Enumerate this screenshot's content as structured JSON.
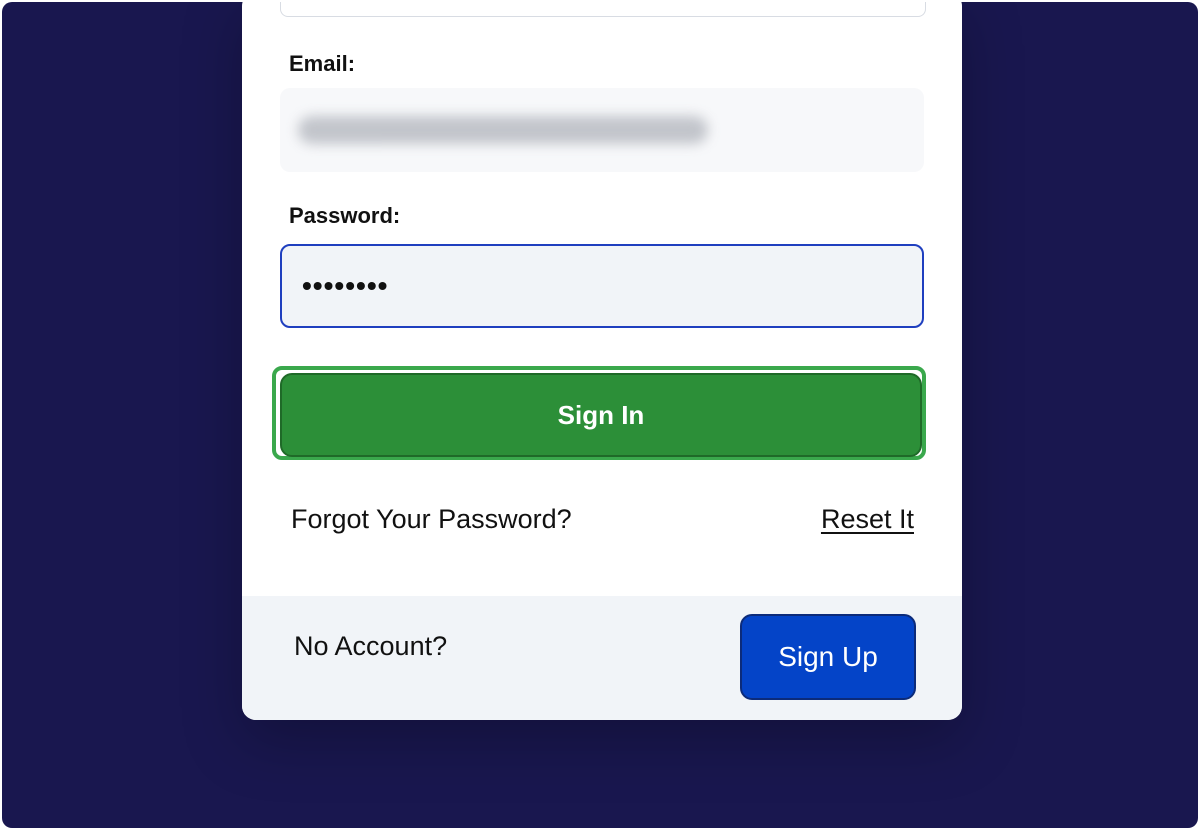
{
  "form": {
    "email_label": "Email:",
    "email_value": "",
    "password_label": "Password:",
    "password_value": "••••••••",
    "sign_in_label": "Sign In",
    "forgot_text": "Forgot Your Password?",
    "reset_link": "Reset It"
  },
  "footer": {
    "no_account_text": "No Account?",
    "sign_up_label": "Sign Up"
  },
  "colors": {
    "backdrop": "#19174f",
    "sign_in_button": "#2c8f38",
    "sign_in_highlight": "#3aa84c",
    "sign_up_button": "#0444c8",
    "password_focus_border": "#1f3fbf"
  }
}
